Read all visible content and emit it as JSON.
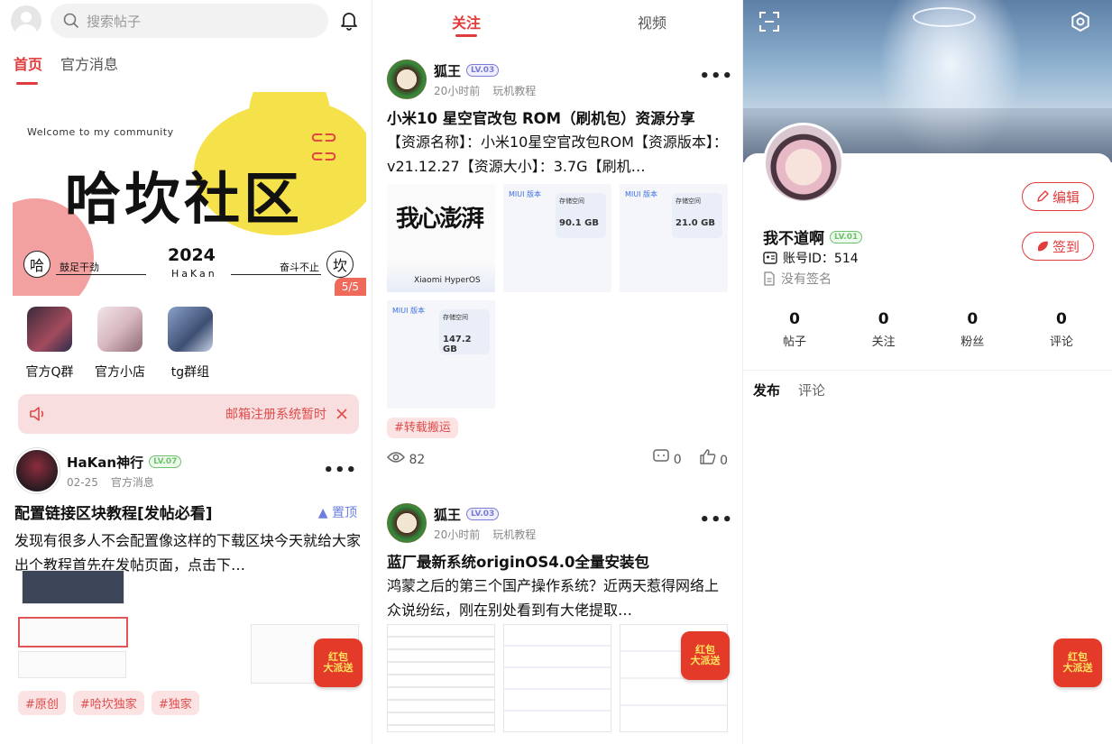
{
  "panel1": {
    "search_placeholder": "搜索帖子",
    "tabs": [
      "首页",
      "官方消息"
    ],
    "banner": {
      "welcome": "Welcome to my community",
      "title": "哈坎社区",
      "year": "2024",
      "brand": "HaKan",
      "left_char": "哈",
      "left_text": "鼓足干劲",
      "right_char": "坎",
      "right_text": "奋斗不止",
      "pager": "5/5"
    },
    "shortcuts": [
      {
        "label": "官方Q群"
      },
      {
        "label": "官方小店"
      },
      {
        "label": "tg群组"
      }
    ],
    "notice": "邮箱注册系统暂时",
    "post": {
      "author": "HaKan神行",
      "level": "LV.07",
      "date": "02-25",
      "category": "官方消息",
      "title": "配置链接区块教程[发帖必看]",
      "pin_label": "置顶",
      "body": "发现有很多人不会配置像这样的下载区块今天就给大家出个教程首先在发帖页面，点击下…",
      "tags": [
        "#原创",
        "#哈坎独家",
        "#独家"
      ]
    },
    "redpack": "红包\n大派送"
  },
  "panel2": {
    "tabs": [
      "关注",
      "视频"
    ],
    "posts": [
      {
        "author": "狐王",
        "level": "LV.03",
        "time": "20小时前",
        "category": "玩机教程",
        "title": "小米10 星空官改包 ROM（刷机包）资源分享",
        "body": "【资源名称】：小米10星空官改包ROM【资源版本】：v21.12.27【资源大小】：3.7G【刷机…",
        "calli": "我心澎湃",
        "hyperos": "Xiaomi HyperOS",
        "storage": [
          "90.1 GB",
          "21.0 GB",
          "147.2 GB"
        ],
        "tag": "#转载搬运",
        "views": "82",
        "comments": "0",
        "likes": "0"
      },
      {
        "author": "狐王",
        "level": "LV.03",
        "time": "20小时前",
        "category": "玩机教程",
        "title": "蓝厂最新系统originOS4.0全量安装包",
        "body": "鸿蒙之后的第三个国产操作系统？近两天惹得网络上众说纷纭，刚在别处看到有大佬提取…"
      }
    ]
  },
  "panel3": {
    "edit_label": "编辑",
    "checkin_label": "签到",
    "username": "我不道啊",
    "level": "LV.01",
    "account_id": "账号ID：514",
    "signature": "没有签名",
    "counts": [
      {
        "n": "0",
        "label": "帖子"
      },
      {
        "n": "0",
        "label": "关注"
      },
      {
        "n": "0",
        "label": "粉丝"
      },
      {
        "n": "0",
        "label": "评论"
      }
    ],
    "tabs": [
      "发布",
      "评论"
    ]
  }
}
